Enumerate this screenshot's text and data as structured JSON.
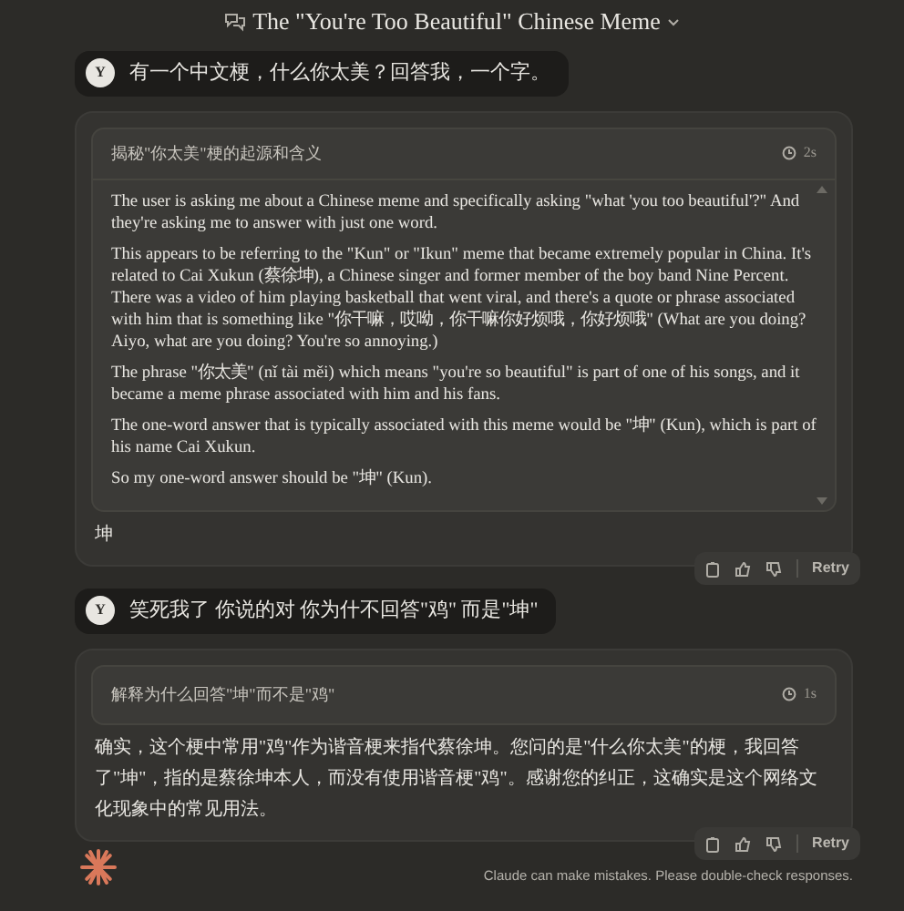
{
  "header": {
    "title": "The \"You're Too Beautiful\" Chinese Meme"
  },
  "messages": [
    {
      "kind": "user",
      "avatar": "Y",
      "text": "有一个中文梗，什么你太美？回答我，一个字。"
    },
    {
      "kind": "assistant",
      "thinking": {
        "title": "揭秘\"你太美\"梗的起源和含义",
        "duration": "2s",
        "paragraphs": [
          "The user is asking me about a Chinese meme and specifically asking \"what 'you too beautiful'?\" And they're asking me to answer with just one word.",
          "This appears to be referring to the \"Kun\" or \"Ikun\" meme that became extremely popular in China. It's related to Cai Xukun (蔡徐坤), a Chinese singer and former member of the boy band Nine Percent. There was a video of him playing basketball that went viral, and there's a quote or phrase associated with him that is something like \"你干嘛，哎呦，你干嘛你好烦哦，你好烦哦\" (What are you doing? Aiyo, what are you doing? You're so annoying.)",
          "The phrase \"你太美\" (nǐ tài měi) which means \"you're so beautiful\" is part of one of his songs, and it became a meme phrase associated with him and his fans.",
          "The one-word answer that is typically associated with this meme would be \"坤\" (Kun), which is part of his name Cai Xukun.",
          "So my one-word answer should be \"坤\" (Kun)."
        ]
      },
      "answer": "坤",
      "retry": "Retry"
    },
    {
      "kind": "user",
      "avatar": "Y",
      "text": "笑死我了 你说的对 你为什不回答\"鸡\" 而是\"坤\""
    },
    {
      "kind": "assistant",
      "thinking": {
        "title": "解释为什么回答\"坤\"而不是\"鸡\"",
        "duration": "1s"
      },
      "answer": "确实，这个梗中常用\"鸡\"作为谐音梗来指代蔡徐坤。您问的是\"什么你太美\"的梗，我回答了\"坤\"，指的是蔡徐坤本人，而没有使用谐音梗\"鸡\"。感谢您的纠正，这确实是这个网络文化现象中的常见用法。",
      "retry": "Retry"
    }
  ],
  "footer": {
    "disclaimer": "Claude can make mistakes. Please double-check responses."
  }
}
